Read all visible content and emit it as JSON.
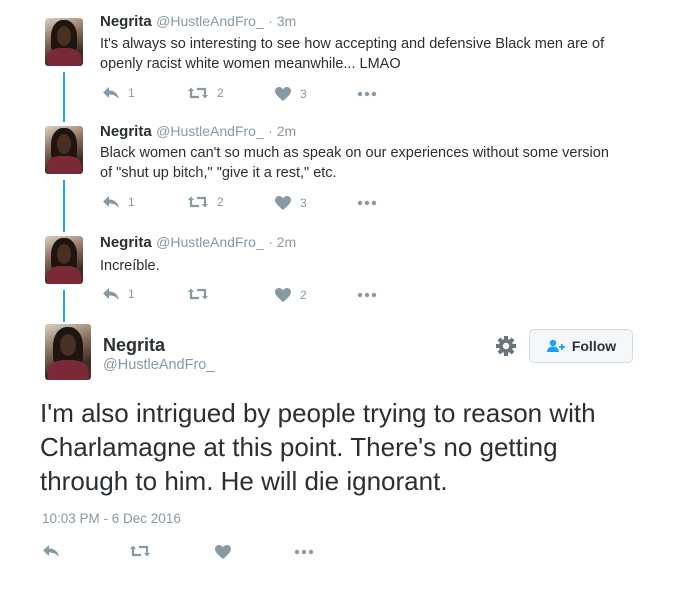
{
  "tweets": [
    {
      "name": "Negrita",
      "handle": "@HustleAndFro_",
      "time": "· 3m",
      "text_lines": [
        "It's always so interesting to see how accepting and defensive Black men are of",
        "openly racist white women meanwhile... LMAO"
      ],
      "replies": "1",
      "retweets": "2",
      "likes": "3"
    },
    {
      "name": "Negrita",
      "handle": "@HustleAndFro_",
      "time": "· 2m",
      "text_lines": [
        "Black women can't so much as speak on our experiences without some version",
        "of \"shut up bitch,\" \"give it a rest,\" etc."
      ],
      "replies": "1",
      "retweets": "2",
      "likes": "3"
    },
    {
      "name": "Negrita",
      "handle": "@HustleAndFro_",
      "time": "· 2m",
      "text_lines": [
        "Increíble."
      ],
      "replies": "1",
      "retweets": "",
      "likes": "2"
    }
  ],
  "main": {
    "name": "Negrita",
    "handle": "@HustleAndFro_",
    "follow_label": "Follow",
    "text_lines": [
      "I'm also intrigued by people trying to reason with",
      "Charlamagne at this point. There's no getting",
      "through to him. He will die ignorant."
    ],
    "timestamp": "10:03 PM - 6 Dec 2016"
  },
  "icons": {
    "reply": "reply-icon",
    "retweet": "retweet-icon",
    "like": "heart-icon",
    "more": "more-icon",
    "gear": "gear-icon",
    "follow": "follow-person-icon"
  },
  "colors": {
    "thread_line": "#1da1f2",
    "icon_gray": "#8899a6",
    "like_blue": "#1da1f2"
  }
}
